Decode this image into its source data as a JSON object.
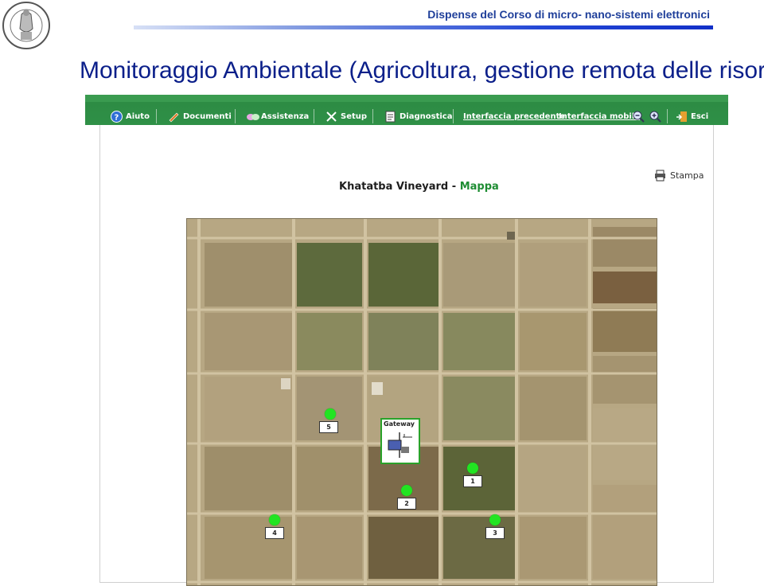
{
  "header": {
    "course": "Dispense del Corso di micro- nano-sistemi elettronici",
    "title": "Monitoraggio Ambientale (Agricoltura, gestione remota delle risorse)"
  },
  "toolbar": {
    "help": "Aiuto",
    "documents": "Documenti",
    "assistance": "Assistenza",
    "setup": "Setup",
    "diagnostics": "Diagnostica",
    "previous_interface": "Interfaccia precedente",
    "mobile_interface": "Interfaccia mobile",
    "exit": "Esci"
  },
  "page": {
    "vineyard": "Khatatba Vineyard",
    "separator": "-",
    "view": "Mappa",
    "print": "Stampa"
  },
  "map": {
    "gateway_label": "Gateway",
    "nodes": [
      "1",
      "2",
      "3",
      "4",
      "5"
    ]
  },
  "colors": {
    "toolbar_green": "#2f9047",
    "node_green": "#22e422",
    "accent_green": "#1e8d33",
    "title_blue": "#0b1f8a"
  }
}
